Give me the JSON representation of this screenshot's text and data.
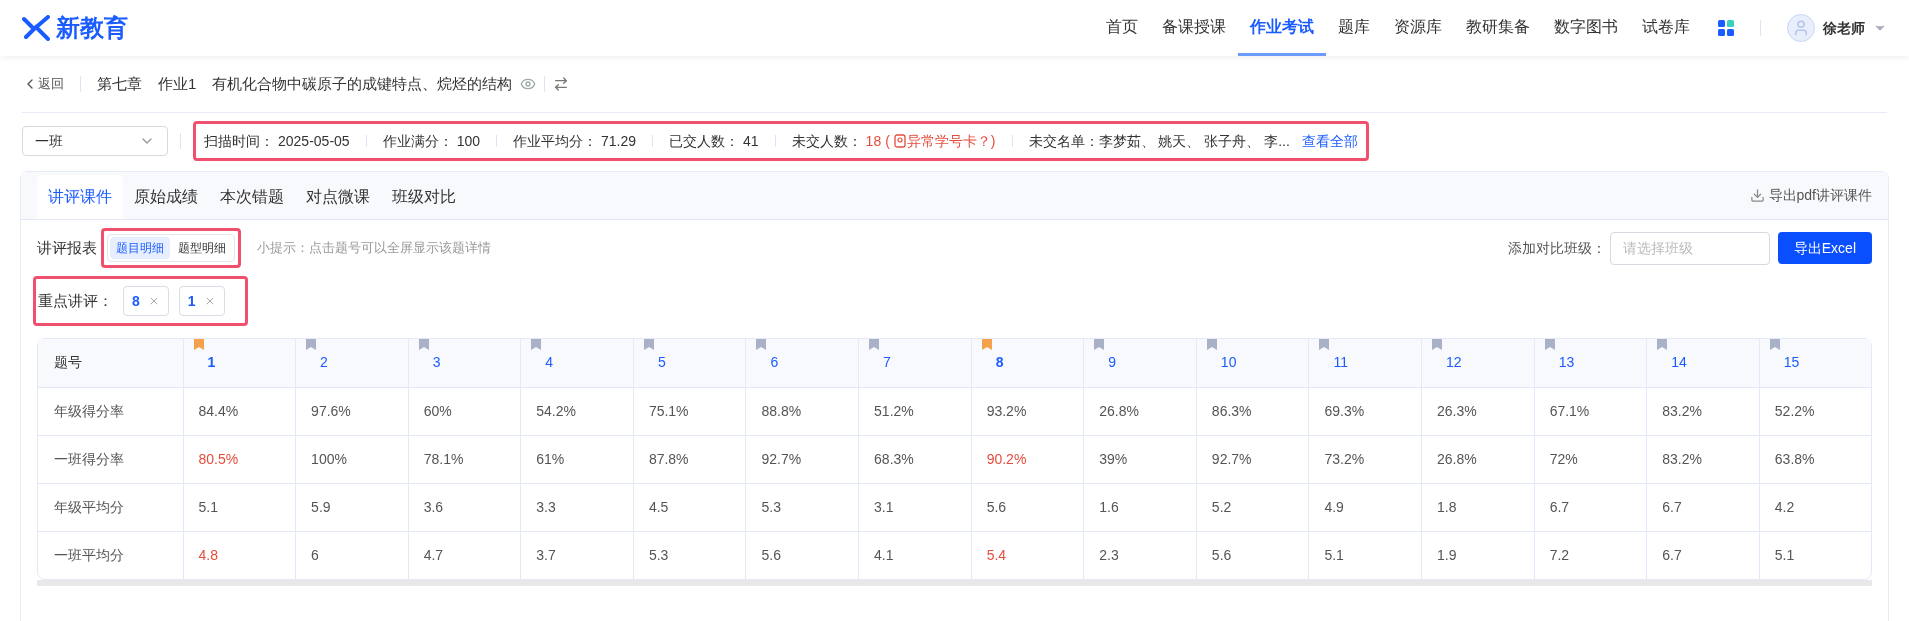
{
  "header": {
    "logo": "新教育",
    "nav": [
      {
        "label": "首页",
        "selected": false
      },
      {
        "label": "备课授课",
        "selected": false
      },
      {
        "label": "作业考试",
        "selected": true
      },
      {
        "label": "题库",
        "selected": false
      },
      {
        "label": "资源库",
        "selected": false
      },
      {
        "label": "教研集备",
        "selected": false
      },
      {
        "label": "数字图书",
        "selected": false
      },
      {
        "label": "试卷库",
        "selected": false
      }
    ],
    "user": "徐老师"
  },
  "breadcrumb": {
    "back": "返回",
    "chapter": "第七章",
    "homework": "作业1",
    "title": "有机化合物中碳原子的成键特点、烷烃的结构"
  },
  "class_select": {
    "value": "一班"
  },
  "info_bar": {
    "highlighted": true,
    "items": [
      {
        "label": "扫描时间：",
        "value": "2025-05-05"
      },
      {
        "label": "作业满分：",
        "value": "100"
      },
      {
        "label": "作业平均分：",
        "value": "71.29"
      },
      {
        "label": "已交人数：",
        "value": "41"
      }
    ],
    "missing_label": "未交人数：",
    "missing_count": "18",
    "missing_open": "(",
    "missing_link": "异常学号卡？",
    "missing_close": ")",
    "missing_list": "未交名单：李梦茹、 姚天、 张子舟、 李...",
    "view_all": "查看全部"
  },
  "tabs": [
    {
      "label": "讲评课件",
      "selected": true
    },
    {
      "label": "原始成绩",
      "selected": false
    },
    {
      "label": "本次错题",
      "selected": false
    },
    {
      "label": "对点微课",
      "selected": false
    },
    {
      "label": "班级对比",
      "selected": false
    }
  ],
  "export_pdf": "导出pdf讲评课件",
  "report": {
    "label": "讲评报表",
    "highlighted": true,
    "options": [
      {
        "label": "题目明细",
        "selected": true
      },
      {
        "label": "题型明细",
        "selected": false
      }
    ],
    "hint": "小提示：点击题号可以全屏显示该题详情"
  },
  "compare": {
    "label": "添加对比班级：",
    "placeholder": "请选择班级",
    "export": "导出Excel"
  },
  "focus": {
    "label": "重点讲评：",
    "highlighted": true,
    "tags": [
      "8",
      "1"
    ]
  },
  "table": {
    "header": "题号",
    "columns": [
      {
        "label": "1",
        "marked": true
      },
      {
        "label": "2",
        "marked": false
      },
      {
        "label": "3",
        "marked": false
      },
      {
        "label": "4",
        "marked": false
      },
      {
        "label": "5",
        "marked": false
      },
      {
        "label": "6",
        "marked": false
      },
      {
        "label": "7",
        "marked": false
      },
      {
        "label": "8",
        "marked": true
      },
      {
        "label": "9",
        "marked": false
      },
      {
        "label": "10",
        "marked": false
      },
      {
        "label": "11",
        "marked": false
      },
      {
        "label": "12",
        "marked": false
      },
      {
        "label": "13",
        "marked": false
      },
      {
        "label": "14",
        "marked": false
      },
      {
        "label": "15",
        "marked": false
      }
    ],
    "rows": [
      {
        "label": "年级得分率",
        "highlight_marked": false,
        "cells": [
          "84.4%",
          "97.6%",
          "60%",
          "54.2%",
          "75.1%",
          "88.8%",
          "51.2%",
          "93.2%",
          "26.8%",
          "86.3%",
          "69.3%",
          "26.3%",
          "67.1%",
          "83.2%",
          "52.2%"
        ]
      },
      {
        "label": "一班得分率",
        "highlight_marked": true,
        "cells": [
          "80.5%",
          "100%",
          "78.1%",
          "61%",
          "87.8%",
          "92.7%",
          "68.3%",
          "90.2%",
          "39%",
          "92.7%",
          "73.2%",
          "26.8%",
          "72%",
          "83.2%",
          "63.8%"
        ]
      },
      {
        "label": "年级平均分",
        "highlight_marked": false,
        "cells": [
          "5.1",
          "5.9",
          "3.6",
          "3.3",
          "4.5",
          "5.3",
          "3.1",
          "5.6",
          "1.6",
          "5.2",
          "4.9",
          "1.8",
          "6.7",
          "6.7",
          "4.2"
        ]
      },
      {
        "label": "一班平均分",
        "highlight_marked": true,
        "cells": [
          "4.8",
          "6",
          "4.7",
          "3.7",
          "5.3",
          "5.6",
          "4.1",
          "5.4",
          "2.3",
          "5.6",
          "5.1",
          "1.9",
          "7.2",
          "6.7",
          "5.1"
        ]
      }
    ]
  }
}
